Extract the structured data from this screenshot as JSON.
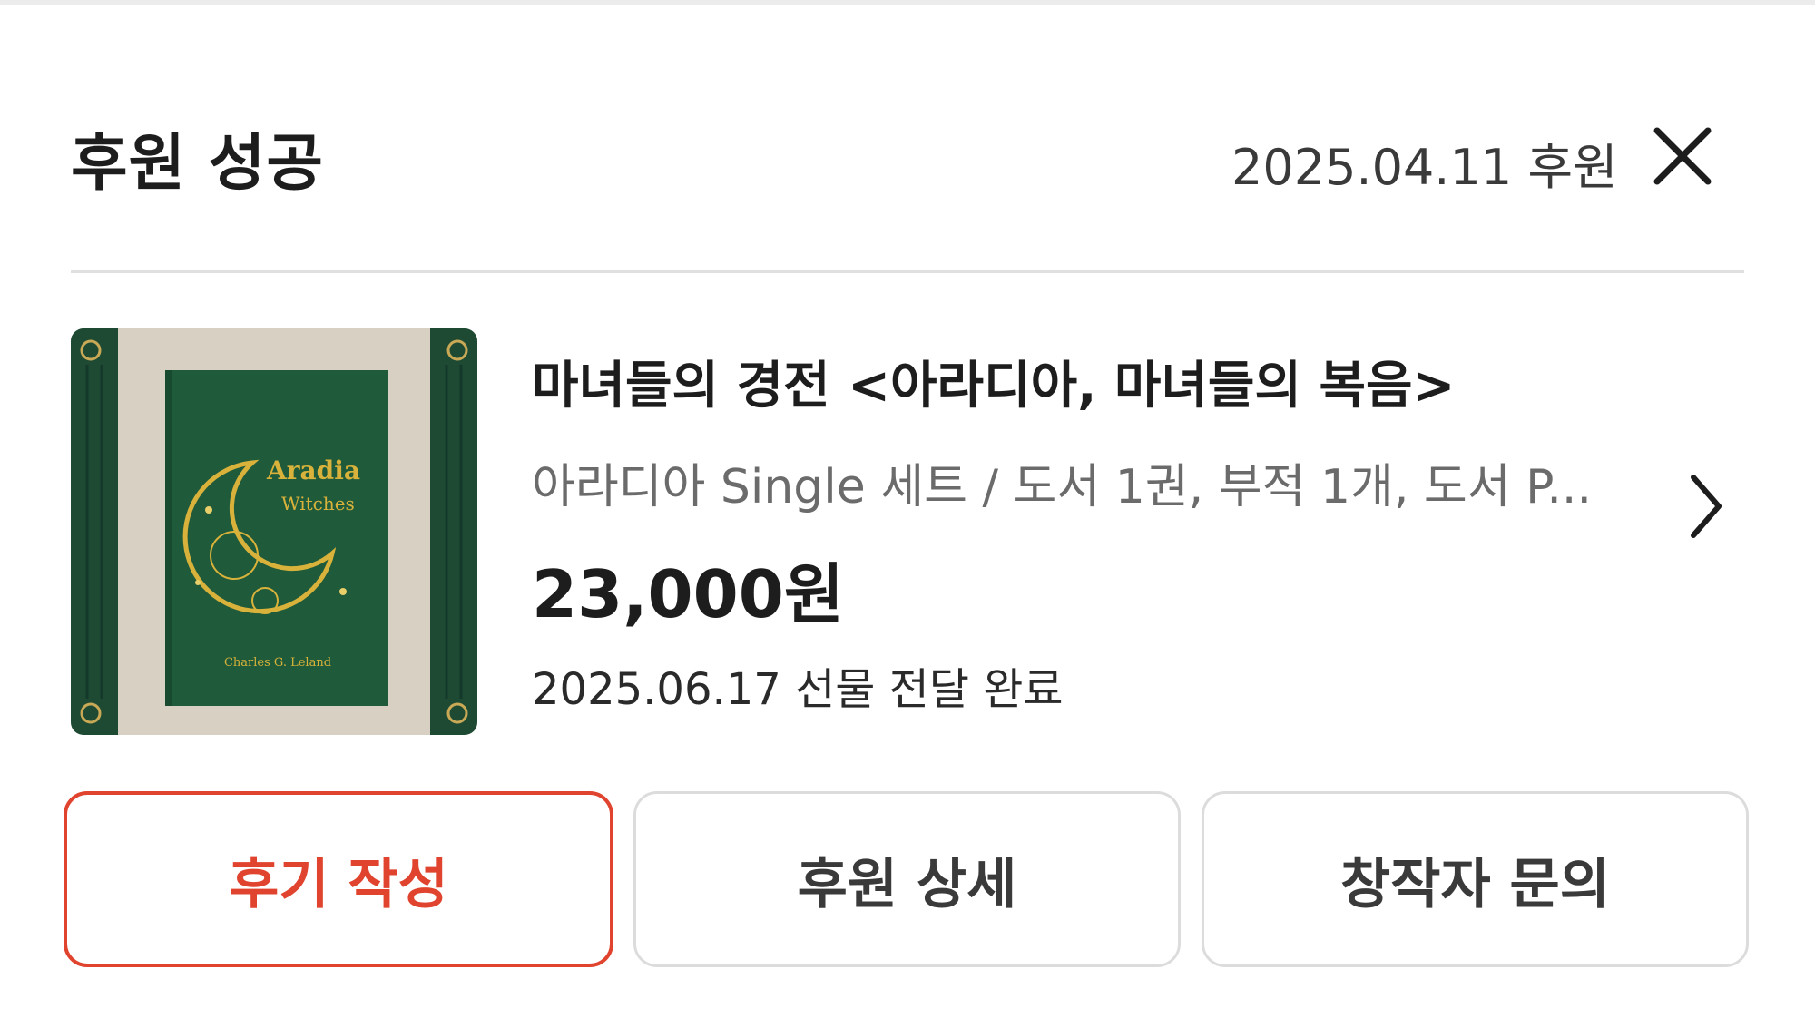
{
  "header": {
    "title": "후원 성공",
    "date": "2025.04.11 후원",
    "close_icon": "close-icon"
  },
  "product": {
    "title": "마녀들의 경전 <아라디아, 마녀들의 복음>",
    "option": "아라디아 Single 세트 / 도서 1권, 부적 1개, 도서 P...",
    "price": "23,000원",
    "delivery_status": "2025.06.17 선물 전달 완료",
    "image": {
      "book_title_line1": "Aradia",
      "book_title_line2": "Witches",
      "book_author": "Charles G. Leland"
    },
    "chevron_icon": "chevron-right-icon"
  },
  "actions": {
    "review_label": "후기 작성",
    "detail_label": "후원 상세",
    "inquiry_label": "창작자 문의"
  },
  "colors": {
    "accent": "#e0442e",
    "text_primary": "#1d1d1d",
    "text_secondary": "#6b6b6b",
    "border": "#dcdcdc",
    "book_green": "#1f5a3a",
    "book_gold": "#d8b23a"
  }
}
